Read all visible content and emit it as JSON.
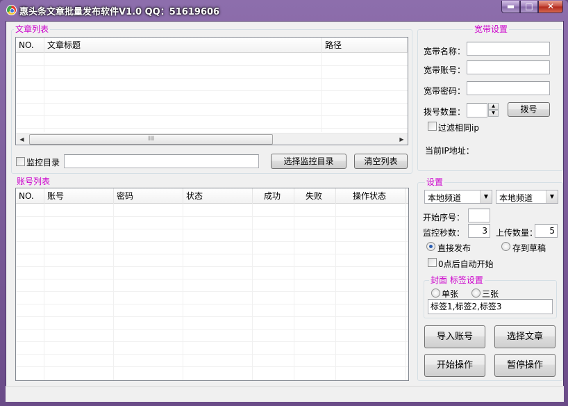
{
  "window": {
    "title": "惠头条文章批量发布软件V1.0 QQ：51619606",
    "minimize_glyph": "▬",
    "maximize_glyph": "□",
    "close_glyph": "✕"
  },
  "articles": {
    "legend": "文章列表",
    "columns": [
      "NO.",
      "文章标题",
      "路径"
    ],
    "rows": [],
    "scroll_left": "◀",
    "scroll_right": "▶",
    "scroll_thumb_grip": "III"
  },
  "monitor": {
    "checkbox_label": "监控目录",
    "checked": false,
    "path_value": "",
    "select_button": "选择监控目录",
    "clear_button": "清空列表"
  },
  "accounts": {
    "legend": "账号列表",
    "columns": [
      "NO.",
      "账号",
      "密码",
      "状态",
      "成功",
      "失败",
      "操作状态"
    ],
    "rows": []
  },
  "broadband": {
    "legend": "宽带设置",
    "name_label": "宽带名称：",
    "name_value": "",
    "account_label": "宽带账号：",
    "account_value": "",
    "password_label": "宽带密码：",
    "password_value": "",
    "dial_count_label": "拨号数量：",
    "dial_count_value": "",
    "dial_button": "拨号",
    "filter_ip_label": "过滤相同ip",
    "filter_ip_checked": false,
    "current_ip_label": "当前IP地址：",
    "current_ip_value": ""
  },
  "settings": {
    "legend": "设置",
    "channel1": "本地频道",
    "channel2": "本地频道",
    "start_index_label": "开始序号：",
    "start_index_value": "",
    "monitor_seconds_label": "监控秒数：",
    "monitor_seconds_value": "3",
    "upload_count_label": "上传数量：",
    "upload_count_value": "5",
    "publish_direct_label": "直接发布",
    "save_draft_label": "存到草稿",
    "publish_mode": "direct",
    "auto_start_label": "0点后自动开始",
    "auto_start_checked": false
  },
  "cover": {
    "legend": "封面 标签设置",
    "single_label": "单张",
    "triple_label": "三张",
    "tags_value": "标签1,标签2,标签3"
  },
  "actions": {
    "import_accounts": "导入账号",
    "select_articles": "选择文章",
    "start": "开始操作",
    "pause": "暂停操作"
  },
  "colors": {
    "legend": "#cc00cc",
    "window_frame": "#7a5b98"
  },
  "icons": {
    "app": "app-logo-icon",
    "arrow_up": "▲",
    "arrow_down": "▼",
    "combo_arrow": "▼"
  }
}
